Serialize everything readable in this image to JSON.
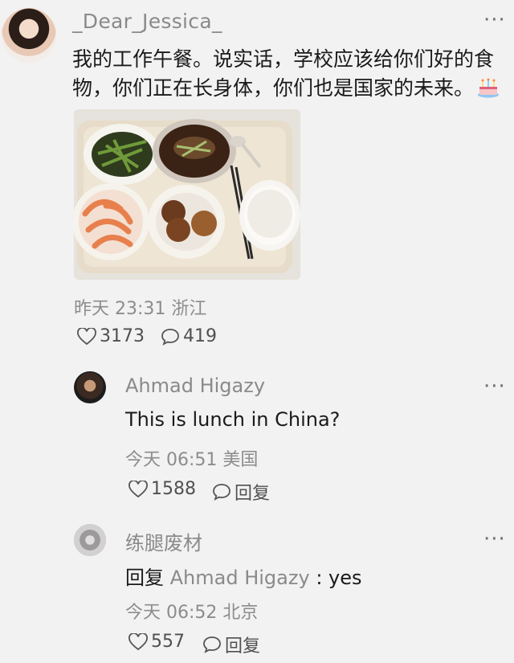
{
  "post": {
    "username": "_Dear_Jessica_",
    "more": "···",
    "text_line1": "我的工作午餐。说实话，学校应该给你们好的食",
    "text_line2": "物，你们正在长身体，你们也是国家的未来。",
    "emoji": "cake-emoji",
    "time": "昨天 23:31",
    "location": "浙江",
    "likes": "3173",
    "comments": "419"
  },
  "comments": [
    {
      "name": "Ahmad Higazy",
      "text": "This is lunch in China?",
      "time": "今天 06:51",
      "location": "美国",
      "likes": "1588",
      "reply_label": "回复",
      "more": "···"
    },
    {
      "name": "练腿废材",
      "reply_prefix": "回复",
      "reply_to": "Ahmad Higazy",
      "reply_text": ": yes",
      "time": "今天 06:52",
      "location": "北京",
      "likes": "557",
      "reply_label": "回复",
      "more": "···"
    }
  ],
  "colors": {
    "background": "#f2f2f2",
    "secondary_text": "#8a8a8a",
    "primary_text": "#1a1a1a"
  }
}
